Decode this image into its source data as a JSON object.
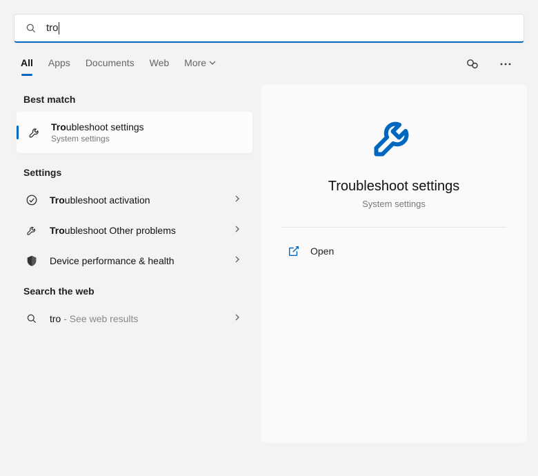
{
  "search": {
    "value": "tro"
  },
  "tabs": {
    "items": [
      "All",
      "Apps",
      "Documents",
      "Web",
      "More"
    ],
    "active": 0
  },
  "sections": {
    "best_match": "Best match",
    "settings": "Settings",
    "web": "Search the web"
  },
  "best_match": {
    "prefix": "Tro",
    "rest": "ubleshoot settings",
    "subtitle": "System settings"
  },
  "settings_items": [
    {
      "icon": "check",
      "prefix": "Tro",
      "rest": "ubleshoot activation"
    },
    {
      "icon": "wrench",
      "prefix": "Tro",
      "rest": "ubleshoot Other problems"
    },
    {
      "icon": "shield",
      "prefix": "",
      "rest": "Device performance & health"
    }
  ],
  "web_item": {
    "query": "tro",
    "suffix": " - See web results"
  },
  "detail": {
    "title": "Troubleshoot settings",
    "subtitle": "System settings",
    "actions": [
      {
        "icon": "open",
        "label": "Open"
      }
    ]
  },
  "colors": {
    "accent": "#0067c0"
  }
}
